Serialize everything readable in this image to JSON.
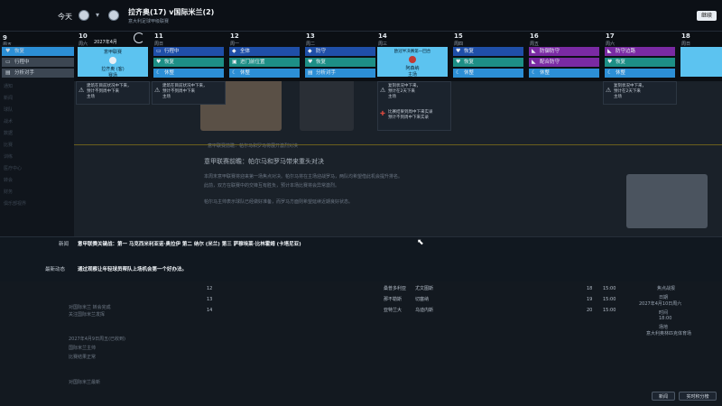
{
  "header": {
    "today": "今天",
    "match_title": "拉齐奥(17) v国际米兰(2)",
    "match_sub": "意大利足球甲级联赛",
    "finish": "继续"
  },
  "strip": {
    "month": "2027年4月",
    "days": [
      {
        "num": "10",
        "name": "周六"
      },
      {
        "num": "11",
        "name": "周日"
      },
      {
        "num": "12",
        "name": "周一"
      },
      {
        "num": "13",
        "name": "周二"
      },
      {
        "num": "14",
        "name": "周三"
      },
      {
        "num": "15",
        "name": "周四"
      },
      {
        "num": "16",
        "name": "周五"
      },
      {
        "num": "17",
        "name": "周六"
      },
      {
        "num": "18",
        "name": "周日"
      }
    ],
    "day0_header": "周五",
    "match_card": {
      "title": "意甲联赛",
      "opponent": "拉齐奥 (客)",
      "status": "赛场"
    },
    "match_card2": {
      "title": "欧冠半决赛第一回合",
      "opponent": "阿森纳",
      "status": "主场"
    }
  },
  "sidebar": {
    "items": [
      {
        "label": "恢复",
        "icon": "heart-icon",
        "color": "#2b7cc8"
      },
      {
        "label": "行程中",
        "icon": "bus-icon",
        "color": "#3c4652"
      },
      {
        "label": "分析对手",
        "icon": "chart-icon",
        "color": "#3c4652"
      }
    ],
    "faded": [
      "通知",
      "新闻",
      "球队",
      "战术",
      "数据",
      "比赛",
      "训练",
      "医疗中心",
      "转会",
      "财务",
      "俱乐部视界"
    ]
  },
  "cards": {
    "col1": [
      "行程中",
      "恢复",
      "休整"
    ],
    "col2": [
      "全体",
      "进门前位置",
      "休整"
    ],
    "col3": [
      "防守",
      "恢复",
      "分析对手"
    ],
    "col5": [
      "恢复",
      "恢复",
      "休整"
    ],
    "col6": [
      "防御防守",
      "配合防守",
      "休整"
    ],
    "col7": [
      "防守边路",
      "恢复",
      "休整"
    ]
  },
  "notes": {
    "n1a": "建筑在目前状况中下来，",
    "n1b": "预计不到周中下来",
    "n1c": "主场",
    "n2a": "建筑在目前状况中下来，",
    "n2b": "预计不到周中下来",
    "n2c": "主场",
    "n3a": "复刻状况中下来，",
    "n3b": "预计在2天下来",
    "n3c": "主场",
    "n4a": "比赛结果到周中下来实录",
    "n4b": "预计不到周中下来实录"
  },
  "news": {
    "intro": "意甲联赛前瞻：帕尔马和罗马将展开激烈对决",
    "headline": "意甲联赛前瞻：帕尔马和罗马带来重头对决",
    "p1": "本周末意甲联赛将迎来第一场焦点对决。帕尔马将在主场迎战罗马，两队均希望借此机会提升排名。",
    "p2": "此前，双方在联赛中的交锋互有胜负，预计本场比赛将会异常激烈。",
    "p3": "帕尔马主帅表示球队已经做好准备，而罗马方面则希望延续近期良好状态。",
    "ticker": "欧冠八强对阵揭晓"
  },
  "overlay": {
    "label1": "新闻",
    "text1": "意甲联赛关键战：第一 马克西米利亚诺·奥拉伊 第二 纳尔 (米兰) 第三 萨穆埃莱·比林霍姆 (卡塔尼亚)",
    "label2": "最新动态",
    "text2": "通过观察让年轻球员帮队上场机会第一个好办法。"
  },
  "lower": {
    "left": [
      {
        "text": "对国际米兰 转会完成",
        "sub": "关注国际米兰发挥"
      },
      {
        "text": "2027年4月9日周五(已收到)",
        "sub": "国际米兰主帅"
      },
      {
        "text": "比赛结果正常",
        "sub": "对国际米兰最新"
      }
    ],
    "rows": [
      {
        "num": "12",
        "team": "桑普多利亚",
        "opp": "尤文图斯",
        "pos": "18",
        "time": "15:00"
      },
      {
        "num": "13",
        "team": "那不勒斯",
        "opp": "切塞纳",
        "pos": "19",
        "time": "15:00"
      },
      {
        "num": "14",
        "team": "亚特兰大",
        "opp": "乌迪内斯",
        "pos": "20",
        "time": "15:00"
      }
    ],
    "side": {
      "a": "焦点战报",
      "b": "日期",
      "c": "2027年4月10日周六",
      "d": "时间",
      "e": "18:00",
      "f": "场地",
      "g": "意大利奥林匹克体育场"
    },
    "btn1": "新闻",
    "btn2": "实时积分榜"
  }
}
